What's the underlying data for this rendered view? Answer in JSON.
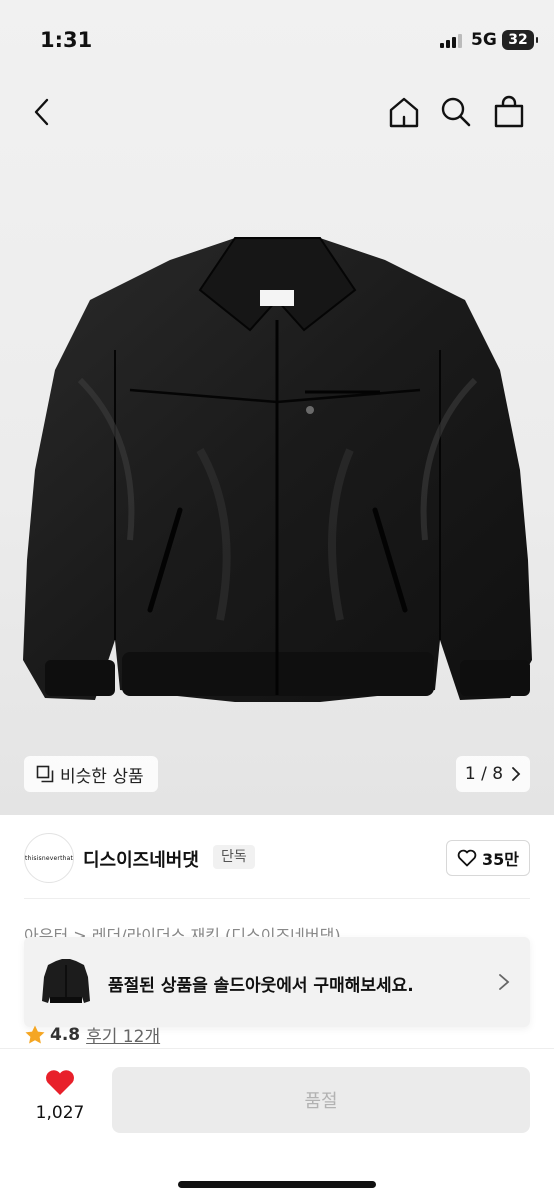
{
  "status_bar": {
    "time": "1:31",
    "network": "5G",
    "battery": "32"
  },
  "nav": {
    "back_icon": "chevron-left-icon",
    "home_icon": "home-icon",
    "search_icon": "search-icon",
    "cart_icon": "shopping-bag-icon"
  },
  "hero": {
    "similar_label": "비슷한 상품",
    "page_indicator": "1 / 8",
    "garment_label": "thisisneverthat"
  },
  "brand": {
    "logo_text": "thisisneverthat",
    "name": "디스이즈네버댓",
    "badge": "단독",
    "likes": "35만"
  },
  "breadcrumb": "아우터 > 레더/라이더스 재킷 (디스이즈네버댓)",
  "toast": {
    "message": "품절된 상품을 솔드아웃에서 구매해보세요."
  },
  "rating": {
    "score": "4.8",
    "reviews": "후기 12개"
  },
  "bottom": {
    "wish_count": "1,027",
    "buy_label": "품절"
  },
  "colors": {
    "heart": "#e8202a",
    "star": "#f5a623",
    "disabled_button": "#ebebeb"
  }
}
